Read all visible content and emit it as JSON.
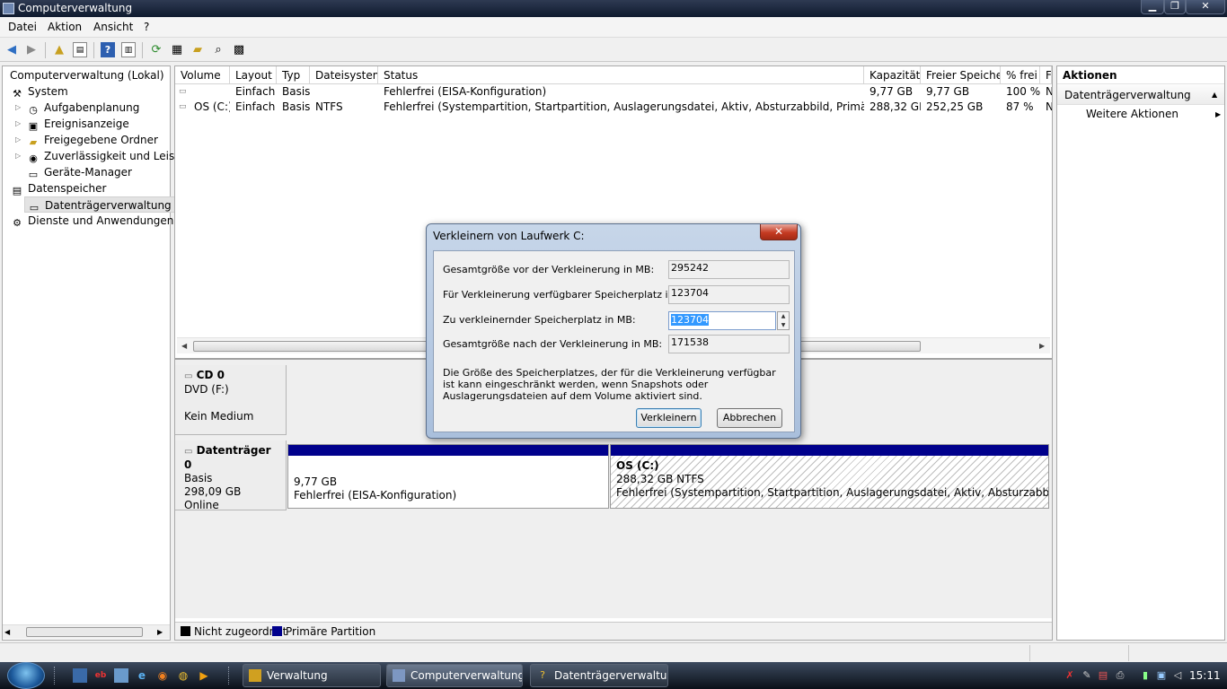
{
  "window": {
    "title": "Computerverwaltung",
    "minimize": "▁",
    "restore": "❐",
    "close": "✕"
  },
  "menu": [
    "Datei",
    "Aktion",
    "Ansicht",
    "?"
  ],
  "tree": {
    "root": "Computerverwaltung (Lokal)",
    "system": "System",
    "aufgaben": "Aufgabenplanung",
    "ereignis": "Ereignisanzeige",
    "ordner": "Freigegebene Ordner",
    "zuverl": "Zuverlässigkeit und Leistur",
    "geraete": "Geräte-Manager",
    "datenspeicher": "Datenspeicher",
    "dtv": "Datenträgerverwaltung",
    "dienste": "Dienste und Anwendungen"
  },
  "table": {
    "columns": [
      "Volume",
      "Layout",
      "Typ",
      "Dateisystem",
      "Status",
      "Kapazität",
      "Freier Speicher",
      "% frei",
      "Fe"
    ],
    "rows": [
      {
        "volume": "",
        "layout": "Einfach",
        "typ": "Basis",
        "dateisystem": "",
        "status": "Fehlerfrei (EISA-Konfiguration)",
        "kapazitaet": "9,77 GB",
        "frei": "9,77 GB",
        "prozent": "100 %",
        "fe": "N"
      },
      {
        "volume": "OS (C:)",
        "layout": "Einfach",
        "typ": "Basis",
        "dateisystem": "NTFS",
        "status": "Fehlerfrei (Systempartition, Startpartition, Auslagerungsdatei, Aktiv, Absturzabbild, Primäre Partition)",
        "kapazitaet": "288,32 GB",
        "frei": "252,25 GB",
        "prozent": "87 %",
        "fe": "N"
      }
    ]
  },
  "disks": {
    "cd": {
      "name": "CD 0",
      "type": "DVD (F:)",
      "status": "Kein Medium"
    },
    "disk0": {
      "name": "Datenträger 0",
      "type": "Basis",
      "size": "298,09 GB",
      "status": "Online"
    },
    "part1": {
      "size": "9,77 GB",
      "status": "Fehlerfrei (EISA-Konfiguration)"
    },
    "part2": {
      "name": "OS  (C:)",
      "size": "288,32 GB NTFS",
      "status": "Fehlerfrei (Systempartition, Startpartition, Auslagerungsdatei, Aktiv, Absturzabbild, Primäre Partition)"
    }
  },
  "legend": {
    "unallocated": "Nicht zugeordnet",
    "primary": "Primäre Partition"
  },
  "actions": {
    "header": "Aktionen",
    "section": "Datenträgerverwaltung",
    "more": "Weitere Aktionen"
  },
  "dialog": {
    "title": "Verkleinern von Laufwerk C:",
    "total_before_label": "Gesamtgröße vor der Verkleinerung in MB:",
    "total_before_value": "295242",
    "available_label": "Für Verkleinerung verfügbarer Speicherplatz in MB:",
    "available_value": "123704",
    "shrink_label": "Zu verkleinernder Speicherplatz in MB:",
    "shrink_value": "123704",
    "total_after_label": "Gesamtgröße nach der Verkleinerung in MB:",
    "total_after_value": "171538",
    "note": "Die Größe des Speicherplatzes, der für die Verkleinerung verfügbar ist kann eingeschränkt werden, wenn Snapshots oder Auslagerungsdateien auf dem Volume aktiviert sind.",
    "ok": "Verkleinern",
    "cancel": "Abbrechen"
  },
  "taskbar": {
    "items": [
      "Verwaltung",
      "Computerverwaltung",
      "Datenträgerverwaltu..."
    ],
    "clock": "15:11"
  },
  "colors": {
    "primary_partition": "#00008c",
    "unallocated": "#000000"
  }
}
